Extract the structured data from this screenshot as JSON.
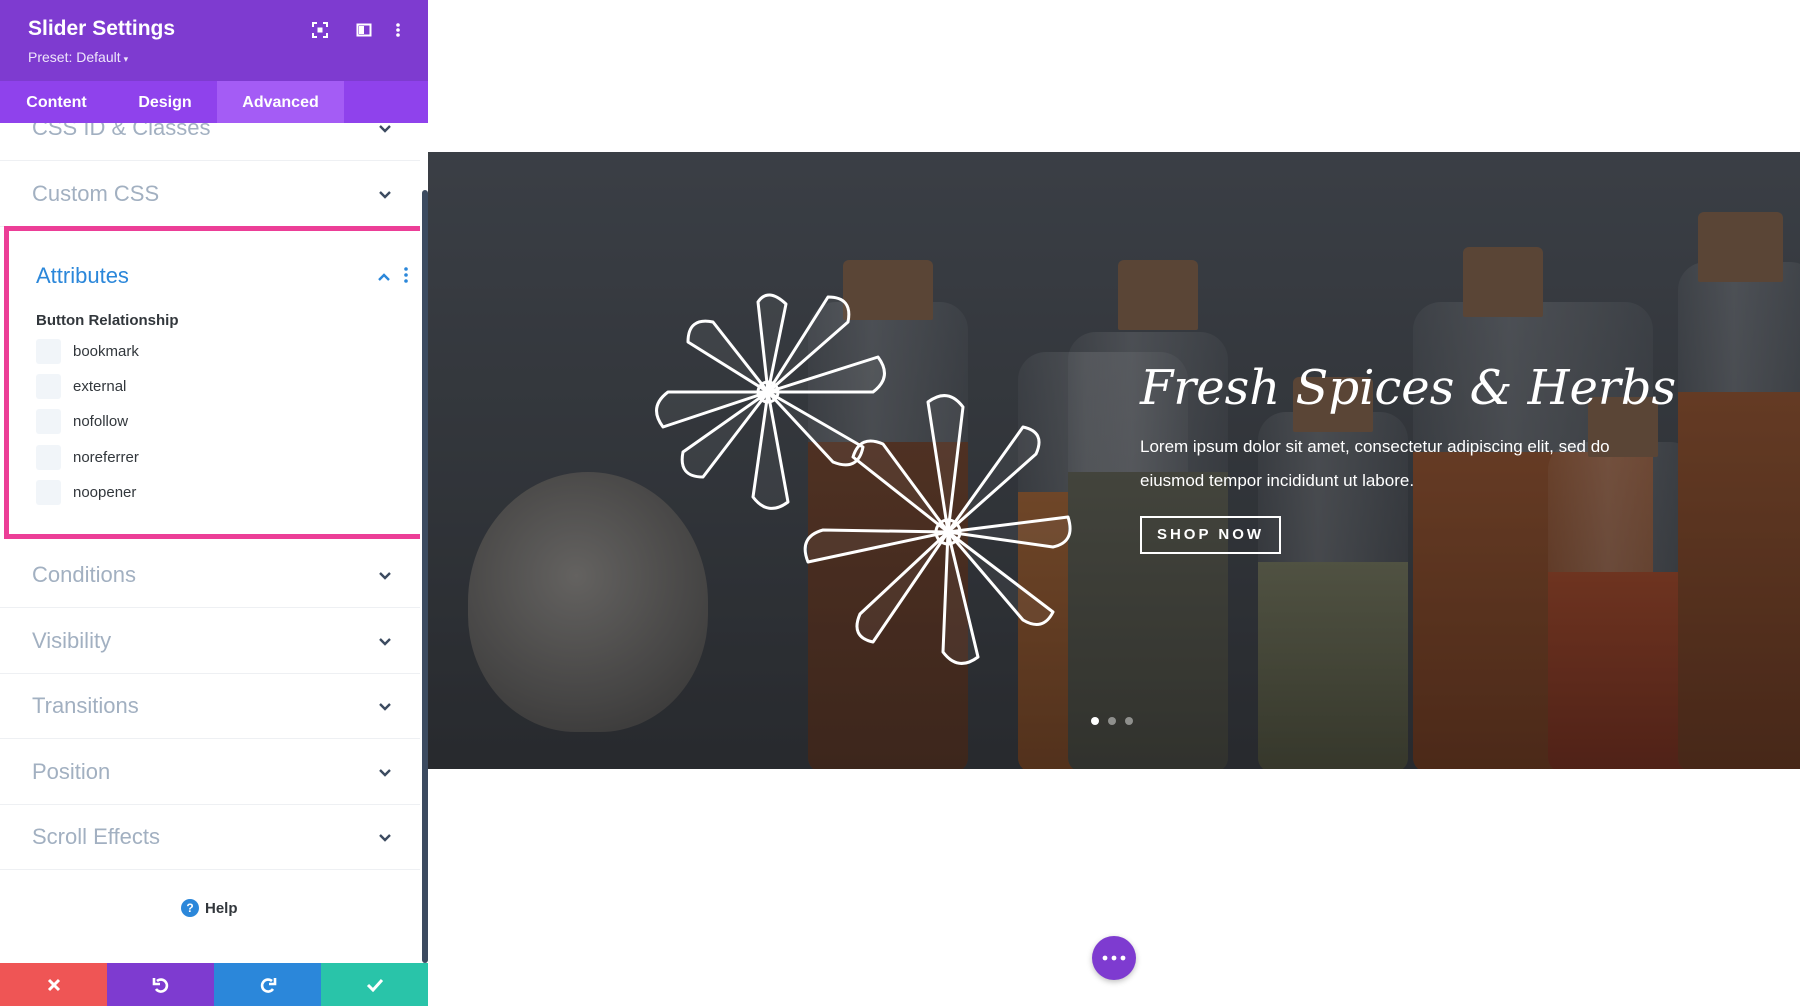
{
  "panel": {
    "title": "Slider Settings",
    "preset": "Preset: Default",
    "icons": [
      "focus-icon",
      "split-view-icon",
      "more-icon"
    ]
  },
  "tabs": [
    {
      "label": "Content",
      "active": false
    },
    {
      "label": "Design",
      "active": false
    },
    {
      "label": "Advanced",
      "active": true
    }
  ],
  "sections": {
    "css_id": "CSS ID & Classes",
    "custom_css": "Custom CSS",
    "attributes": "Attributes",
    "conditions": "Conditions",
    "visibility": "Visibility",
    "transitions": "Transitions",
    "position": "Position",
    "scroll_effects": "Scroll Effects"
  },
  "attributes": {
    "subtitle": "Button Relationship",
    "options": [
      {
        "label": "bookmark",
        "checked": false
      },
      {
        "label": "external",
        "checked": false
      },
      {
        "label": "nofollow",
        "checked": false
      },
      {
        "label": "noreferrer",
        "checked": false
      },
      {
        "label": "noopener",
        "checked": false
      }
    ]
  },
  "help": {
    "label": "Help"
  },
  "footer": {
    "buttons": [
      "close-icon",
      "undo-icon",
      "redo-icon",
      "check-icon"
    ],
    "colors": [
      "#ef5555",
      "#7e3bd0",
      "#2b87da",
      "#29c4a9"
    ]
  },
  "slide": {
    "title": "Fresh Spices & Herbs",
    "text": "Lorem ipsum dolor sit amet, consectetur adipiscing elit, sed do eiusmod tempor incididunt ut labore.",
    "button": "SHOP NOW",
    "dots": 3,
    "active_dot": 0
  },
  "colors": {
    "header": "#7e3bd0",
    "tab_bar": "#8f42ec",
    "tab_active": "#a45cf5",
    "accent_blue": "#2b87da",
    "highlight_border": "#ec3e97"
  }
}
